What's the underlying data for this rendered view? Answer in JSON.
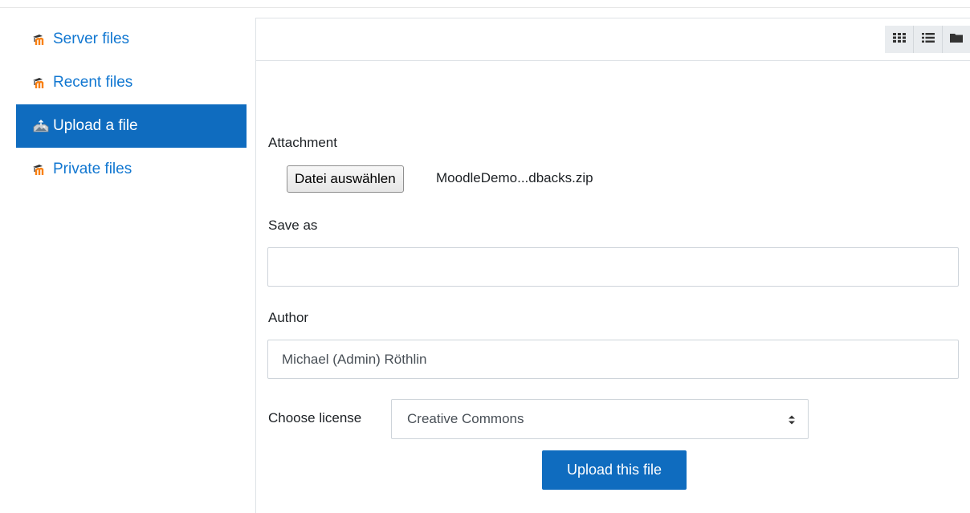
{
  "sidebar": {
    "items": [
      {
        "label": "Server files",
        "icon": "moodle-icon",
        "active": false
      },
      {
        "label": "Recent files",
        "icon": "moodle-icon",
        "active": false
      },
      {
        "label": "Upload a file",
        "icon": "upload-icon",
        "active": true
      },
      {
        "label": "Private files",
        "icon": "moodle-icon",
        "active": false
      }
    ]
  },
  "toolbar": {
    "view_buttons": [
      {
        "icon": "grid-view-icon"
      },
      {
        "icon": "list-view-icon"
      },
      {
        "icon": "folder-view-icon"
      }
    ]
  },
  "form": {
    "attachment_label": "Attachment",
    "choose_file_label": "Datei auswählen",
    "chosen_file_name": "MoodleDemo...dbacks.zip",
    "save_as_label": "Save as",
    "save_as_value": "",
    "author_label": "Author",
    "author_value": "Michael (Admin) Röthlin",
    "license_label": "Choose license",
    "license_selected": "Creative Commons",
    "upload_button_label": "Upload this file"
  },
  "colors": {
    "accent": "#0f6cbf",
    "link": "#1177d1",
    "moodle_orange": "#f98012"
  }
}
